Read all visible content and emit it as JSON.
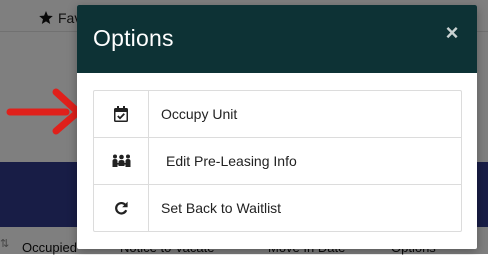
{
  "background": {
    "favorite_label": "Fav",
    "columns": [
      "Occupied",
      "Notice to Vacate",
      "Move In Date",
      "Options"
    ]
  },
  "modal": {
    "title": "Options",
    "close_symbol": "×",
    "options": [
      {
        "label": "Occupy Unit",
        "icon": "calendar-check-icon"
      },
      {
        "label": "Edit Pre-Leasing Info",
        "icon": "people-group-icon"
      },
      {
        "label": "Set Back to Waitlist",
        "icon": "redo-icon"
      }
    ]
  },
  "colors": {
    "header_bg": "#0d3235",
    "arrow": "#e0201b",
    "band": "#303a8c"
  }
}
